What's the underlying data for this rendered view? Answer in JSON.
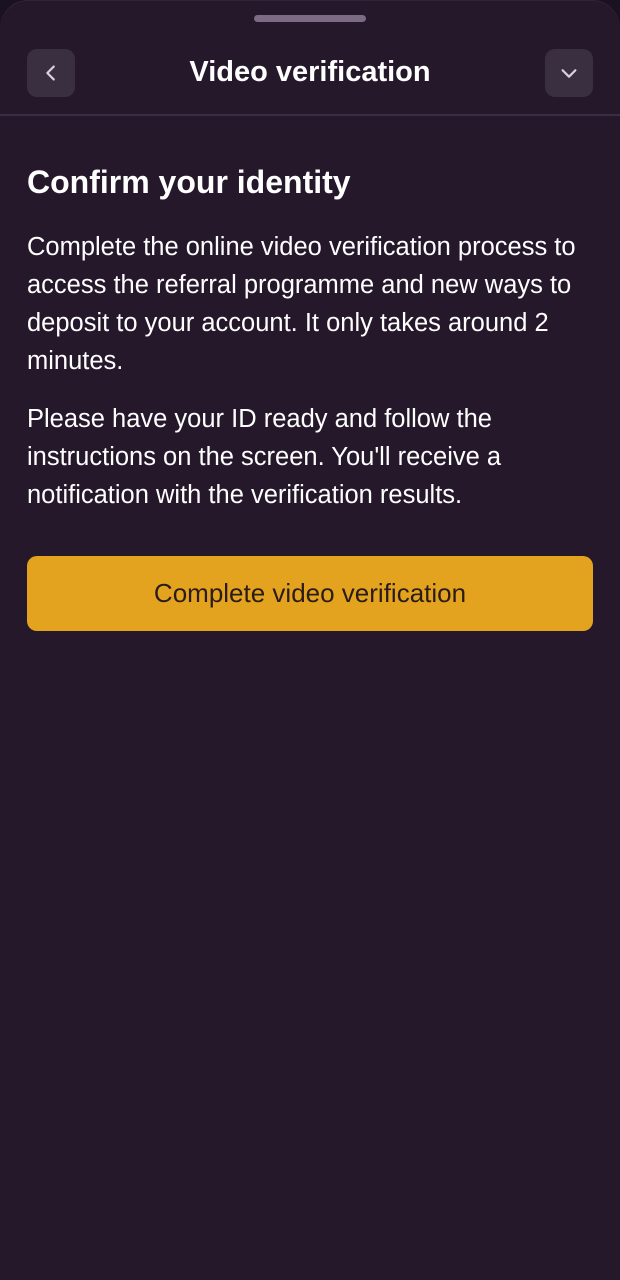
{
  "header": {
    "title": "Video verification",
    "back_icon": "chevron-left-icon",
    "collapse_icon": "chevron-down-icon"
  },
  "content": {
    "heading": "Confirm your identity",
    "paragraph_1": "Complete the online video verification process to access the referral programme and new ways to deposit to your account. It only takes around 2 minutes.",
    "paragraph_2": "Please have your ID ready and follow the instructions on the screen. You'll receive a notification with the verification results."
  },
  "cta": {
    "label": "Complete video verification"
  },
  "colors": {
    "background": "#24182a",
    "accent": "#e4a31f",
    "icon_button_bg": "#3a2f41",
    "text": "#ffffff",
    "button_text": "#2a1c17"
  }
}
